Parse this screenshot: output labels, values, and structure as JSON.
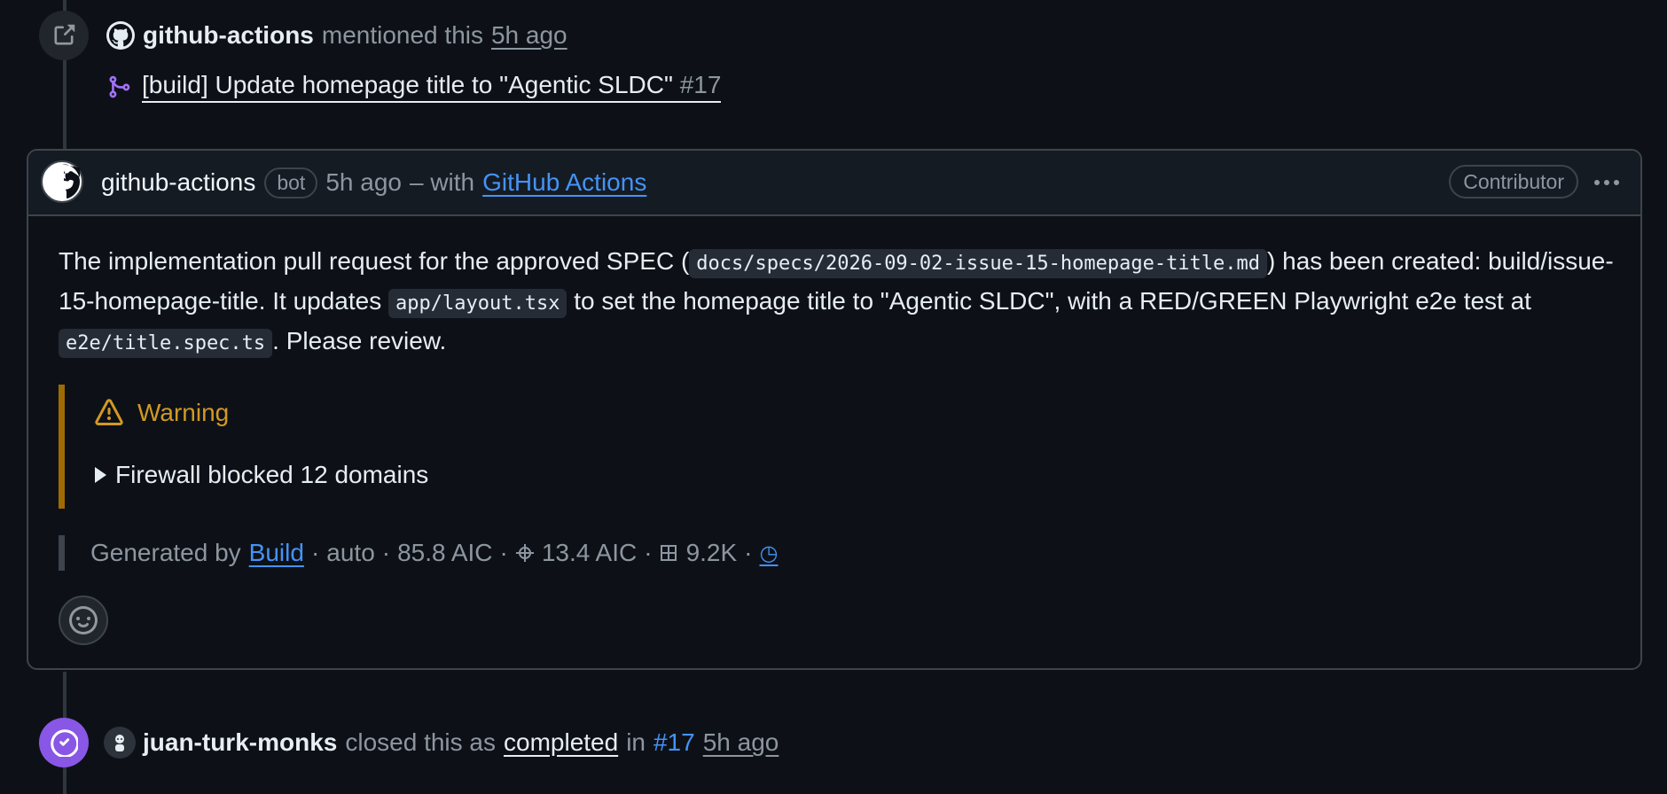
{
  "mention_event": {
    "actor": "github-actions",
    "action": "mentioned this",
    "time": "5h ago",
    "ref_title": "[build] Update homepage title to \"Agentic SLDC\"",
    "ref_number": "#17",
    "icon": "link-external-icon"
  },
  "comment": {
    "author": "github-actions",
    "bot_label": "bot",
    "time": "5h ago",
    "with_text": "– with",
    "app_link": "GitHub Actions",
    "role_badge": "Contributor",
    "body": {
      "p1": "The implementation pull request for the approved SPEC (",
      "code1": "docs/specs/2026-09-02-issue-15-homepage-title.md",
      "p2": ") has been created: build/issue-15-homepage-title. It updates ",
      "code2": "app/layout.tsx",
      "p3": " to set the homepage title to \"Agentic SLDC\", with a RED/GREEN Playwright e2e test at ",
      "code3": "e2e/title.spec.ts",
      "p4": ". Please review."
    },
    "warning": {
      "title": "Warning",
      "details_summary": "Firewall blocked 12 domains",
      "color": "#d29922"
    },
    "footer": {
      "generated_by": "Generated by",
      "workflow_link": "Build",
      "sep": "·",
      "mode": "auto",
      "cost1": "85.8 AIC",
      "cost2": "13.4 AIC",
      "tokens": "9.2K",
      "clock_glyph": "◷"
    }
  },
  "close_event": {
    "actor": "juan-turk-monks",
    "action": "closed this as",
    "state": "completed",
    "in_text": "in",
    "ref_number": "#17",
    "time": "5h ago",
    "icon_color": "#8957e5"
  },
  "colors": {
    "background": "#0d1117",
    "link": "#4493f8",
    "muted": "#8d96a0",
    "border": "#3d444d",
    "branch_icon": "#a371f7"
  }
}
